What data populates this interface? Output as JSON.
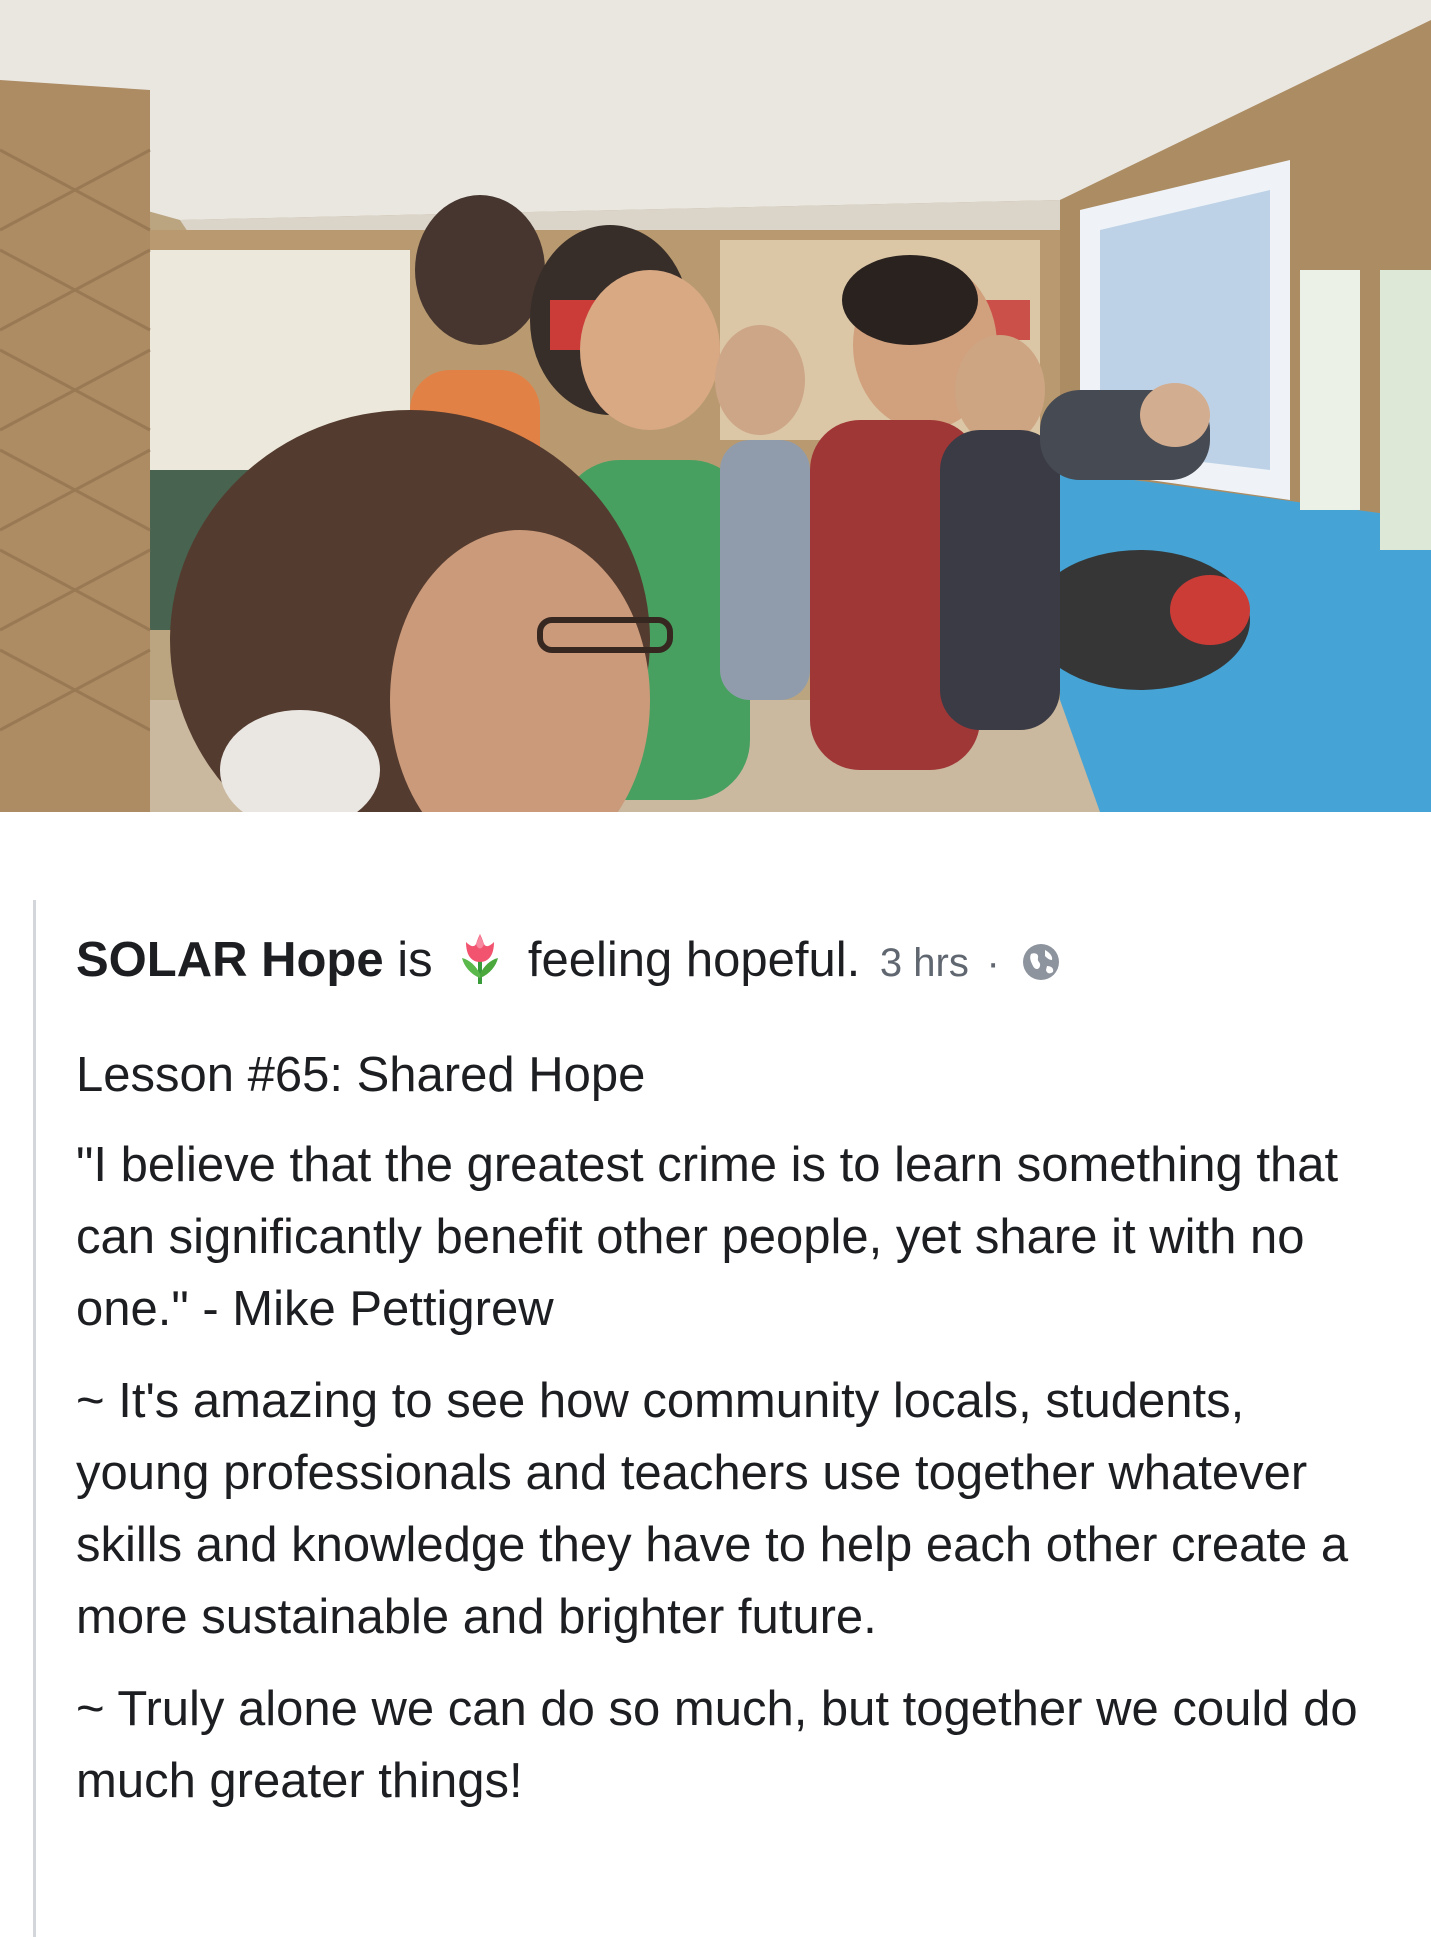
{
  "post": {
    "page_name": "SOLAR Hope",
    "is_word": "is",
    "feeling_icon": "tulip-emoji",
    "feeling_text": "feeling hopeful.",
    "timestamp": "3 hrs",
    "separator": "·",
    "privacy_icon": "globe-icon",
    "paragraphs": [
      "Lesson #65: Shared Hope",
      "\"I believe that the greatest crime is to learn something that can significantly benefit other people, yet share it with no one.\" - Mike Pettigrew",
      "~ It's amazing to see how community locals, students, young professionals and teachers use together whatever skills and knowledge they have to help each other create a more sustainable and brighter future.",
      "~ Truly alone we can do so much, but together we could do much greater things!"
    ]
  },
  "colors": {
    "text": "#1c1e21",
    "meta": "#606770",
    "divider": "#d3d6db"
  }
}
